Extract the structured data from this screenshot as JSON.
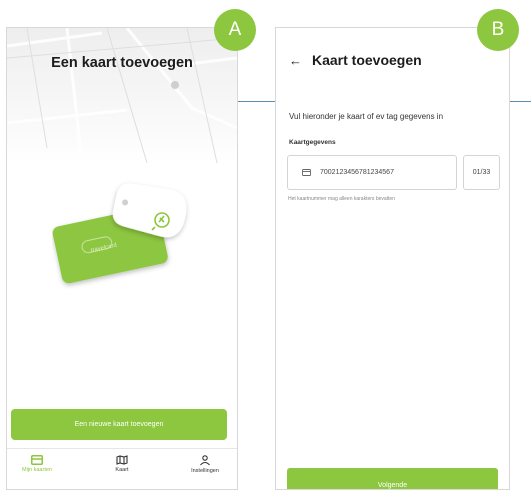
{
  "badges": {
    "a": "A",
    "b": "B"
  },
  "screen_a": {
    "title": "Een kaart toevoegen",
    "illustration": {
      "card_text": "travelcard",
      "tag_icon": "ev-plug-icon"
    },
    "add_button": "Een nieuwe kaart toevoegen",
    "nav": [
      {
        "label": "Mijn kaarten",
        "icon": "card-icon",
        "active": true
      },
      {
        "label": "Kaart",
        "icon": "map-icon",
        "active": false
      },
      {
        "label": "Instellingen",
        "icon": "person-icon",
        "active": false
      }
    ]
  },
  "screen_b": {
    "back_icon": "arrow-left-icon",
    "title": "Kaart toevoegen",
    "instruction": "Vul hieronder je kaart of ev tag gegevens in",
    "section_label": "Kaartgegevens",
    "card_number": "7002123456781234567",
    "expiry": "01/33",
    "hint": "Het kaartnummer mag alleen karakters bevatten",
    "next_button": "Volgende"
  },
  "colors": {
    "accent": "#8dc63f",
    "divider": "#5b8fb0"
  }
}
